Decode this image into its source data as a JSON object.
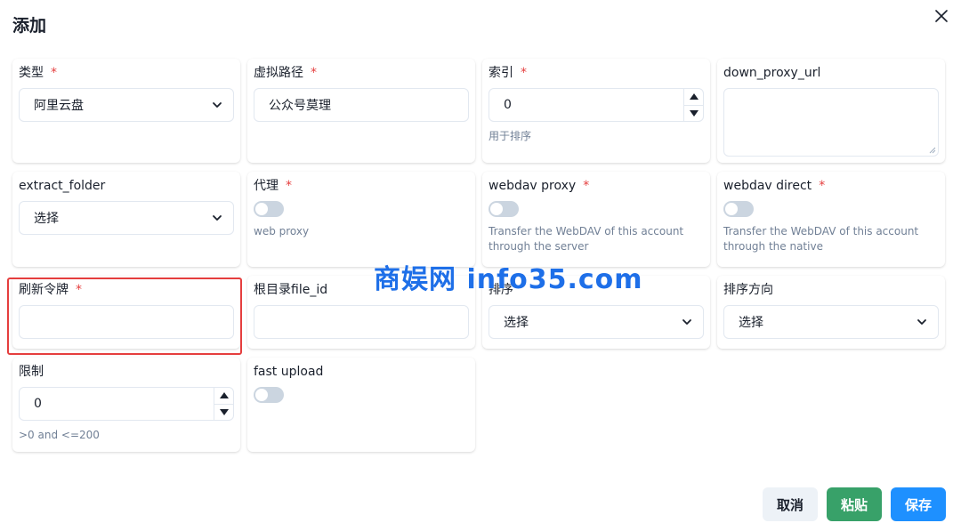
{
  "dialog": {
    "title": "添加"
  },
  "fields": {
    "type": {
      "label": "类型",
      "required": "*",
      "value": "阿里云盘"
    },
    "mount_path": {
      "label": "虚拟路径",
      "required": "*",
      "value": "公众号莫理"
    },
    "order": {
      "label": "索引",
      "required": "*",
      "value": "0",
      "help": "用于排序"
    },
    "down_proxy_url": {
      "label": "down_proxy_url",
      "value": ""
    },
    "extract_folder": {
      "label": "extract_folder",
      "value": "选择"
    },
    "proxy": {
      "label": "代理",
      "required": "*",
      "help": "web proxy",
      "enabled": false
    },
    "webdav_proxy": {
      "label": "webdav proxy",
      "required": "*",
      "help": "Transfer the WebDAV of this account through the server",
      "enabled": false
    },
    "webdav_direct": {
      "label": "webdav direct",
      "required": "*",
      "help": "Transfer the WebDAV of this account through the native",
      "enabled": false
    },
    "refresh_token": {
      "label": "刷新令牌",
      "required": "*",
      "value": ""
    },
    "root_folder_id": {
      "label": "根目录file_id",
      "value": ""
    },
    "order_by": {
      "label": "排序",
      "value": "选择"
    },
    "order_direction": {
      "label": "排序方向",
      "value": "选择"
    },
    "limit": {
      "label": "限制",
      "value": "0",
      "help": ">0 and <=200"
    },
    "fast_upload": {
      "label": "fast upload",
      "enabled": false
    }
  },
  "watermark": "商娱网 info35.com",
  "buttons": {
    "cancel": "取消",
    "paste": "粘贴",
    "save": "保存"
  },
  "colors": {
    "required": "#e53e3e",
    "paste_button": "#38a169",
    "save_button": "#1e90ff",
    "cancel_button": "#edf2f7",
    "highlight_box": "#e53e3e",
    "watermark": "#1e6fe8"
  },
  "icons": {
    "close": "close-icon",
    "select": "chevron-down-icon",
    "spinner_up": "triangle-up-icon",
    "spinner_down": "triangle-down-icon"
  }
}
